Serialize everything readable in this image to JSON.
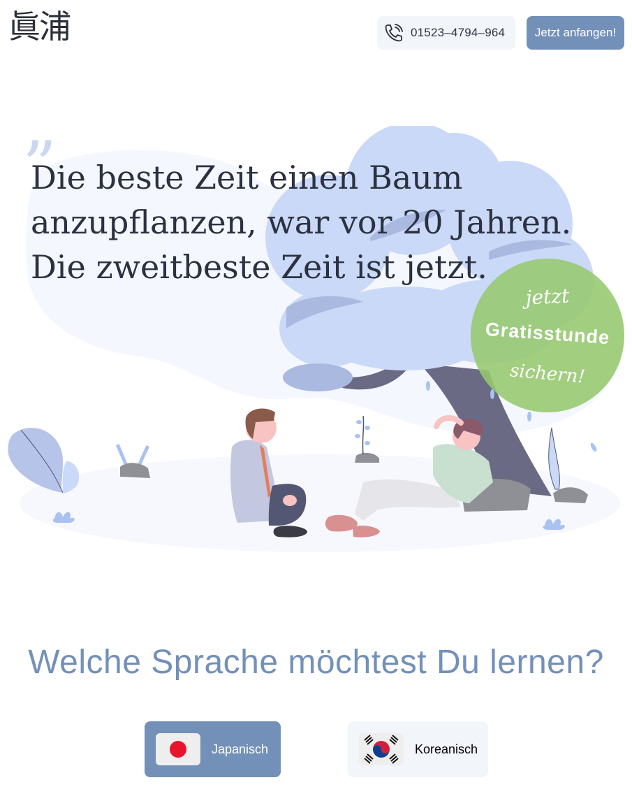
{
  "header": {
    "logo_text": "眞浦",
    "phone_number": "01523–4794–964",
    "cta_label": "Jetzt anfangen!"
  },
  "hero": {
    "quote_mark": "”",
    "quote_lines": [
      "Die beste Zeit einen Baum",
      "anzupflanzen, war vor 20 Jahren.",
      "Die zweitbeste Zeit ist jetzt."
    ],
    "badge": {
      "line1": "jetzt",
      "line2": "Gratisstunde",
      "line3": "sichern!"
    }
  },
  "languages": {
    "title": "Welche Sprache möchtest Du lernen?",
    "options": [
      {
        "label": "Japanisch",
        "flag": "japan-flag-icon",
        "selected": true
      },
      {
        "label": "Koreanisch",
        "flag": "korea-flag-icon",
        "selected": false
      }
    ]
  },
  "colors": {
    "accent": "#7390b8",
    "badge": "#96c86e",
    "light_bg": "#f2f5fa",
    "tree": "#c9d9f7"
  }
}
